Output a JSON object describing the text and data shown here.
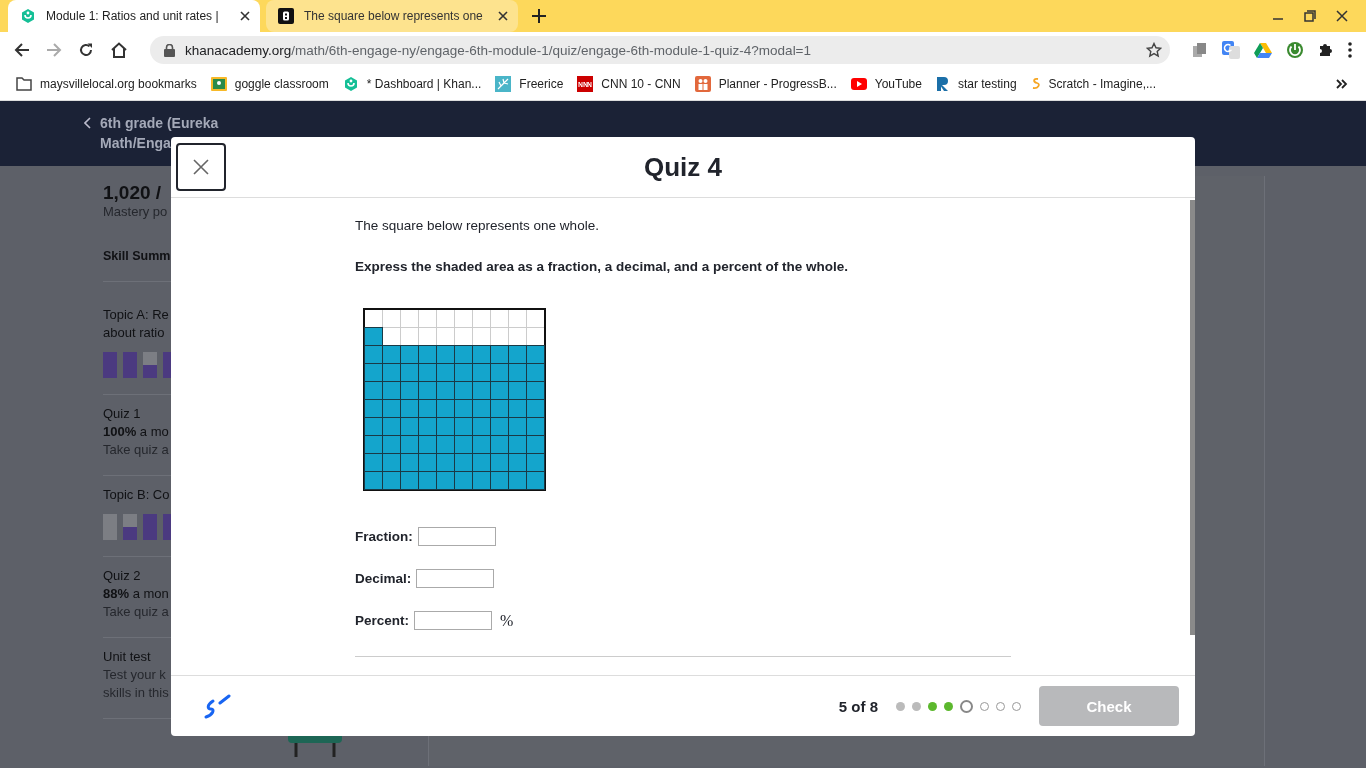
{
  "browser": {
    "tabs": [
      {
        "title": "Module 1: Ratios and unit rates |",
        "kind": "khan",
        "selected": true
      },
      {
        "title": "The square below represents one",
        "kind": "b",
        "selected": false
      }
    ],
    "url_host": "khanacademy.org",
    "url_path": "/math/6th-engage-ny/engage-6th-module-1/quiz/engage-6th-module-1-quiz-4?modal=1",
    "bookmarks": [
      {
        "label": "maysvillelocal.org bookmarks",
        "kind": "folder"
      },
      {
        "label": "goggle classroom",
        "kind": "classroom"
      },
      {
        "label": "* Dashboard | Khan...",
        "kind": "khan"
      },
      {
        "label": "Freerice",
        "kind": "freerice"
      },
      {
        "label": "CNN 10 - CNN",
        "kind": "cnn"
      },
      {
        "label": "Planner - ProgressB...",
        "kind": "planner"
      },
      {
        "label": "YouTube",
        "kind": "youtube"
      },
      {
        "label": "star testing",
        "kind": "r"
      },
      {
        "label": "Scratch - Imagine,...",
        "kind": "scratch"
      }
    ]
  },
  "page": {
    "back_title": [
      "6th grade (Eureka",
      "Math/Enga"
    ],
    "points": "1,020 /",
    "points_label": "Mastery po",
    "section": "Skill Summ",
    "items": [
      {
        "kind": "topic",
        "lines": [
          "Topic A: Re",
          "about ratio"
        ],
        "bars": [
          {
            "level": 1
          },
          {
            "level": 1
          },
          {
            "level": 0.5
          },
          {
            "level": 1
          }
        ]
      },
      {
        "kind": "quiz",
        "title": "Quiz 1",
        "score": "100%",
        "score_rest": " a mo",
        "action": "Take quiz a"
      },
      {
        "kind": "topic",
        "lines": [
          "Topic B: Co"
        ],
        "bars": [
          {
            "level": 0
          },
          {
            "level": 0.5
          },
          {
            "level": 1
          },
          {
            "level": 1
          }
        ]
      },
      {
        "kind": "quiz",
        "title": "Quiz 2",
        "score": "88%",
        "score_rest": " a mon",
        "action": "Take quiz a"
      },
      {
        "kind": "test",
        "title": "Unit test",
        "lines": [
          "Test your k",
          "skills in this"
        ]
      }
    ]
  },
  "modal": {
    "title": "Quiz 4",
    "intro": "The square below represents one whole.",
    "prompt": "Express the shaded area as a fraction, a decimal, and a percent of the whole.",
    "grid": [
      [
        false,
        false,
        false,
        false,
        false,
        false,
        false,
        false,
        false,
        false
      ],
      [
        true,
        false,
        false,
        false,
        false,
        false,
        false,
        false,
        false,
        false
      ],
      [
        true,
        true,
        true,
        true,
        true,
        true,
        true,
        true,
        true,
        true
      ],
      [
        true,
        true,
        true,
        true,
        true,
        true,
        true,
        true,
        true,
        true
      ],
      [
        true,
        true,
        true,
        true,
        true,
        true,
        true,
        true,
        true,
        true
      ],
      [
        true,
        true,
        true,
        true,
        true,
        true,
        true,
        true,
        true,
        true
      ],
      [
        true,
        true,
        true,
        true,
        true,
        true,
        true,
        true,
        true,
        true
      ],
      [
        true,
        true,
        true,
        true,
        true,
        true,
        true,
        true,
        true,
        true
      ],
      [
        true,
        true,
        true,
        true,
        true,
        true,
        true,
        true,
        true,
        true
      ],
      [
        true,
        true,
        true,
        true,
        true,
        true,
        true,
        true,
        true,
        true
      ]
    ],
    "fields": [
      {
        "label": "Fraction:"
      },
      {
        "label": "Decimal:"
      },
      {
        "label": "Percent:",
        "suffix": "%"
      }
    ],
    "progress": "5 of 8",
    "dots": [
      {
        "kind": "done"
      },
      {
        "kind": "done"
      },
      {
        "kind": "correct"
      },
      {
        "kind": "correct"
      },
      {
        "kind": "current"
      },
      {
        "kind": "todo"
      },
      {
        "kind": "todo"
      },
      {
        "kind": "todo"
      }
    ],
    "check": {
      "label": "Check",
      "disabled": true
    }
  }
}
